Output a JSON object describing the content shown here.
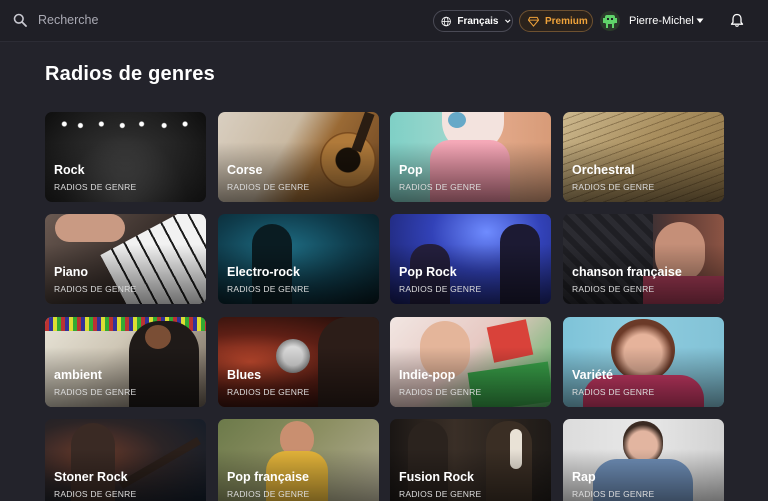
{
  "header": {
    "search_placeholder": "Recherche",
    "language": "Français",
    "premium": "Premium",
    "user_name": "Pierre-Michel"
  },
  "page_title": "Radios de genres",
  "tile_subtitle": "RADIOS DE GENRE",
  "genres": [
    {
      "name": "Rock",
      "subtitle": "RADIOS DE GENRE"
    },
    {
      "name": "Corse",
      "subtitle": "RADIOS DE GENRE"
    },
    {
      "name": "Pop",
      "subtitle": "RADIOS DE GENRE"
    },
    {
      "name": "Orchestral",
      "subtitle": "RADIOS DE GENRE"
    },
    {
      "name": "Piano",
      "subtitle": "RADIOS DE GENRE"
    },
    {
      "name": "Electro-rock",
      "subtitle": "RADIOS DE GENRE"
    },
    {
      "name": "Pop Rock",
      "subtitle": "RADIOS DE GENRE"
    },
    {
      "name": "chanson française",
      "subtitle": "RADIOS DE GENRE"
    },
    {
      "name": "ambient",
      "subtitle": "RADIOS DE GENRE"
    },
    {
      "name": "Blues",
      "subtitle": "RADIOS DE GENRE"
    },
    {
      "name": "Indie-pop",
      "subtitle": "RADIOS DE GENRE"
    },
    {
      "name": "Variété",
      "subtitle": "RADIOS DE GENRE"
    },
    {
      "name": "Stoner Rock",
      "subtitle": "RADIOS DE GENRE"
    },
    {
      "name": "Pop française",
      "subtitle": "RADIOS DE GENRE"
    },
    {
      "name": "Fusion Rock",
      "subtitle": "RADIOS DE GENRE"
    },
    {
      "name": "Rap",
      "subtitle": "RADIOS DE GENRE"
    }
  ],
  "colors": {
    "background": "#23232b",
    "header": "#1f1f26",
    "premium_accent": "#f0a33a"
  },
  "icons": [
    "search-icon",
    "globe-icon",
    "chevron-down-icon",
    "gem-icon",
    "avatar-icon",
    "bell-icon"
  ]
}
